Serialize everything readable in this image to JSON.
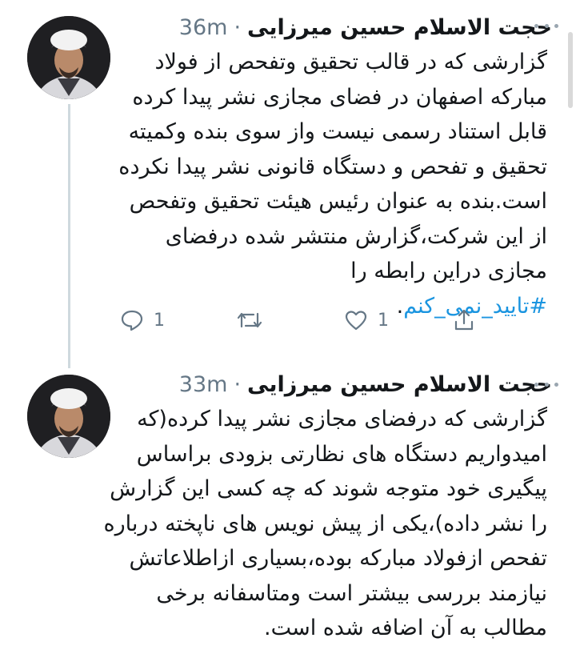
{
  "tweets": [
    {
      "author": "حجت الاسلام حسین میرزایی",
      "separator": "·",
      "time": "36m",
      "text": "گزارشی که در قالب تحقیق وتفحص از فولاد مبارکه اصفهان در فضای مجازی نشر پیدا کرده قابل استناد رسمی نیست واز سوی بنده وکمیته تحقیق و تفحص و دستگاه قانونی نشر پیدا نکرده است.بنده به عنوان رئیس هیئت تحقیق وتفحص از این شرکت،گزارش منتشر شده درفضای مجازی دراین رابطه را",
      "hashtag": "#تایید_نمی_کنم",
      "hashtag_suffix": ".",
      "reply_count": "1",
      "like_count": "1"
    },
    {
      "author": "حجت الاسلام حسین میرزایی",
      "separator": "·",
      "time": "33m",
      "text": "گزارشی که درفضای مجازی نشر پیدا کرده(که امیدواریم دستگاه های نظارتی بزودی براساس پیگیری خود متوجه شوند که چه کسی این گزارش را نشر داده)،یکی از پیش نویس های ناپخته درباره تفحص ازفولاد مبارکه بوده،بسیاری ازاطلاعاتش نیازمند بررسی بیشتر است ومتاسفانه برخی مطالب به آن اضافه شده است."
    }
  ]
}
